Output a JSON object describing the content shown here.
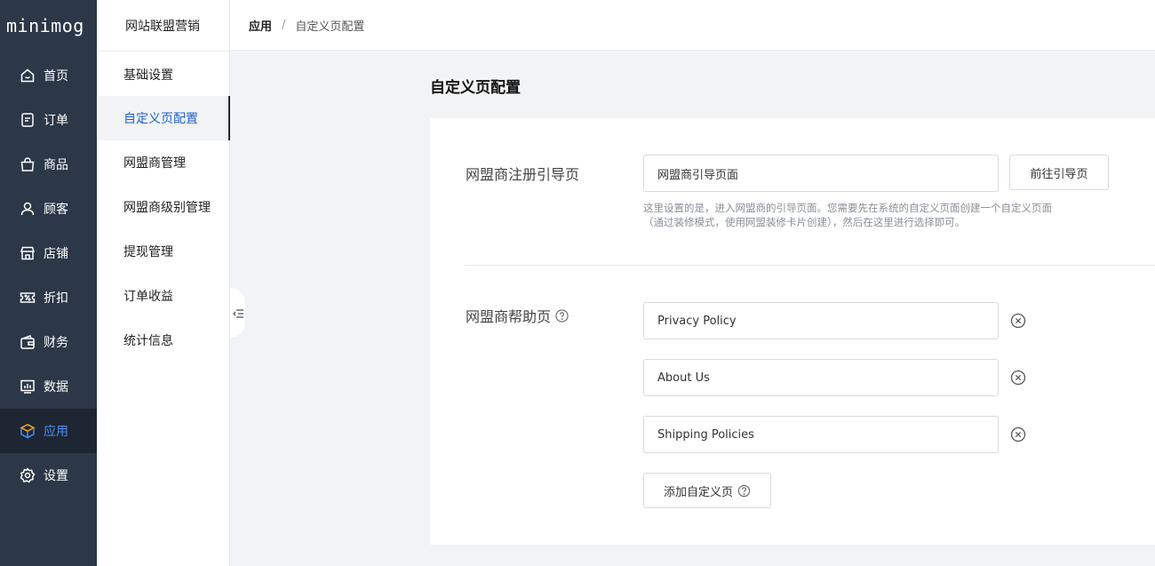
{
  "app": {
    "logo": "minimog"
  },
  "nav": {
    "items": [
      {
        "label": "首页",
        "icon": "home-icon"
      },
      {
        "label": "订单",
        "icon": "order-icon"
      },
      {
        "label": "商品",
        "icon": "bag-icon"
      },
      {
        "label": "顾客",
        "icon": "user-icon"
      },
      {
        "label": "店铺",
        "icon": "store-icon"
      },
      {
        "label": "折扣",
        "icon": "discount-icon"
      },
      {
        "label": "财务",
        "icon": "wallet-icon"
      },
      {
        "label": "数据",
        "icon": "chart-icon"
      },
      {
        "label": "应用",
        "icon": "cube-icon",
        "active": true
      },
      {
        "label": "设置",
        "icon": "gear-icon"
      }
    ],
    "active_color": "#4b8ef7"
  },
  "subnav": {
    "title": "网站联盟营销",
    "items": [
      {
        "label": "基础设置"
      },
      {
        "label": "自定义页配置",
        "active": true
      },
      {
        "label": "网盟商管理"
      },
      {
        "label": "网盟商级别管理"
      },
      {
        "label": "提现管理"
      },
      {
        "label": "订单收益"
      },
      {
        "label": "统计信息"
      }
    ]
  },
  "breadcrumb": {
    "root": "应用",
    "separator": "/",
    "current": "自定义页配置"
  },
  "main": {
    "title": "自定义页配置",
    "register": {
      "label": "网盟商注册引导页",
      "value": "网盟商引导页面",
      "button": "前往引导页",
      "hint_line1": "这里设置的是，进入网盟商的引导页面。您需要先在系统的自定义页面创建一个自定义页面",
      "hint_line2": "（通过装修模式，使用网盟装修卡片创建），然后在这里进行选择即可。"
    },
    "help": {
      "label": "网盟商帮助页",
      "pages": [
        "Privacy Policy",
        "About Us",
        "Shipping Policies"
      ],
      "add_button": "添加自定义页"
    }
  }
}
